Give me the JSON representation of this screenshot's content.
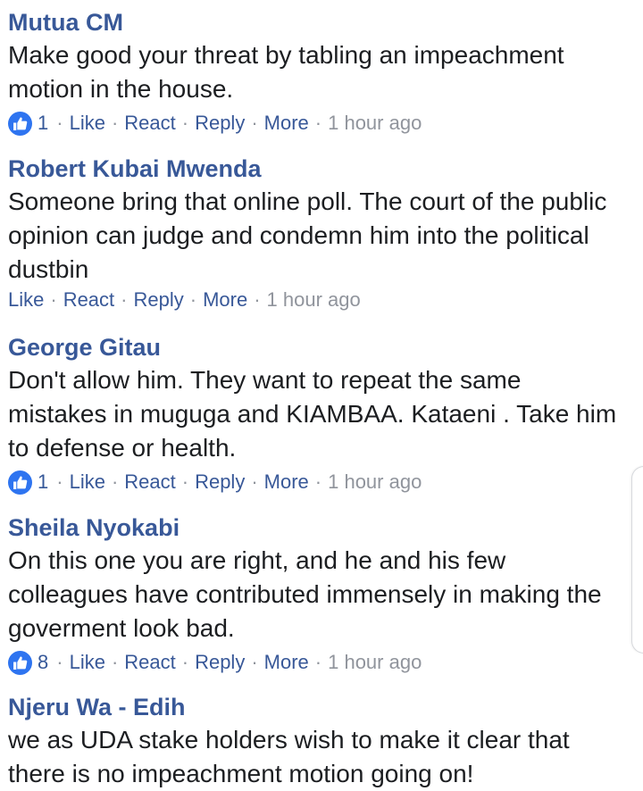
{
  "comments": [
    {
      "author": "Mutua CM",
      "text": "Make good your threat by tabling an impeachment motion in the house.",
      "reactions": "1",
      "actions": {
        "like": "Like",
        "react": "React",
        "reply": "Reply",
        "more": "More"
      },
      "time": "1 hour ago"
    },
    {
      "author": "Robert Kubai Mwenda",
      "text": "Someone bring that online poll. The court of the public opinion can judge and condemn him into the political dustbin",
      "actions": {
        "like": "Like",
        "react": "React",
        "reply": "Reply",
        "more": "More"
      },
      "time": "1 hour ago"
    },
    {
      "author": "George Gitau",
      "text": "Don't allow him. They want to repeat the same mistakes in muguga and KIAMBAA. Kataeni . Take him to defense or health.",
      "reactions": "1",
      "actions": {
        "like": "Like",
        "react": "React",
        "reply": "Reply",
        "more": "More"
      },
      "time": "1 hour ago"
    },
    {
      "author": "Sheila Nyokabi",
      "text": "On this one you are right, and he and his few colleagues have contributed immensely in making the goverment look bad.",
      "reactions": "8",
      "actions": {
        "like": "Like",
        "react": "React",
        "reply": "Reply",
        "more": "More"
      },
      "time": "1 hour ago"
    },
    {
      "author": "Njeru Wa - Edih",
      "text": "we as UDA stake holders wish to make it clear that there is no impeachment motion going on!",
      "actions": {}
    }
  ],
  "separator": "·",
  "icons": {
    "reaction": "thumbs-up-icon"
  },
  "colors": {
    "name": "#385898",
    "text": "#1c1e21",
    "meta": "#90949c",
    "like_badge": "#2e74f0"
  }
}
